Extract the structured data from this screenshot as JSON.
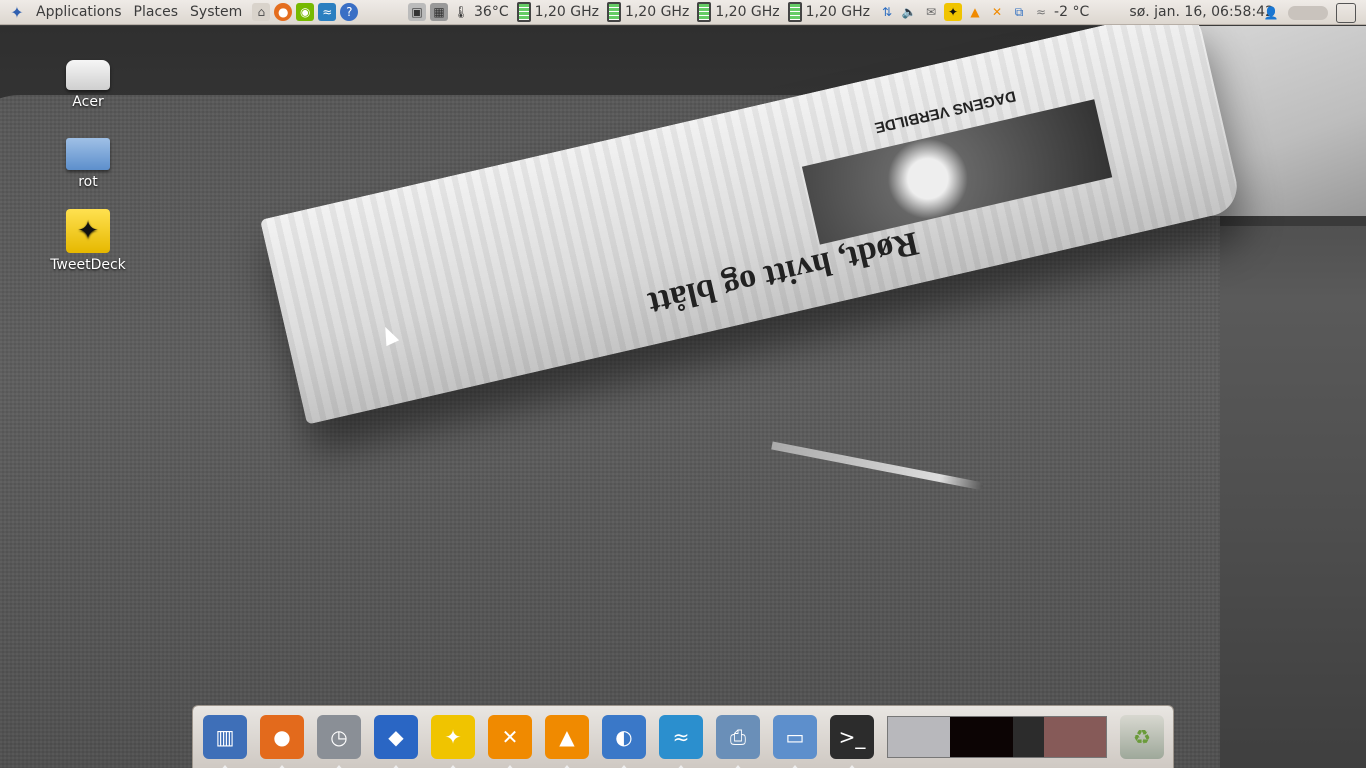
{
  "top_panel": {
    "menus": [
      "Applications",
      "Places",
      "System"
    ],
    "temperature": "36°C",
    "cpu_freqs": [
      "1,20 GHz",
      "1,20 GHz",
      "1,20 GHz",
      "1,20 GHz"
    ],
    "weather": "-2 °C",
    "clock": "sø. jan. 16, 06:58:42",
    "icons": [
      "distributor-logo-icon",
      "home-folder-icon",
      "firefox-icon",
      "nvidia-icon",
      "system-monitor-icon",
      "help-icon"
    ]
  },
  "desktop_icons": [
    {
      "label": "Acer",
      "icon": "drive-icon"
    },
    {
      "label": "rot",
      "icon": "folder-icon"
    },
    {
      "label": "TweetDeck",
      "icon": "tweetdeck-icon"
    }
  ],
  "wallpaper": {
    "headline": "Rødt, hvitt og blått",
    "band": "DAGENS VERBILDE"
  },
  "dock": {
    "items": [
      {
        "name": "file-manager",
        "glyph": "▥",
        "color": "#3e6fb8"
      },
      {
        "name": "firefox",
        "glyph": "●",
        "color": "#e36a1c"
      },
      {
        "name": "mail-clock",
        "glyph": "◷",
        "color": "#8a8f96"
      },
      {
        "name": "drop",
        "glyph": "◆",
        "color": "#2a66c4"
      },
      {
        "name": "tweetdeck",
        "glyph": "✦",
        "color": "#f0c400"
      },
      {
        "name": "xchat",
        "glyph": "✕",
        "color": "#f08a00"
      },
      {
        "name": "vlc",
        "glyph": "▲",
        "color": "#f08a00"
      },
      {
        "name": "evolution",
        "glyph": "◐",
        "color": "#3a78c8"
      },
      {
        "name": "system-monitor",
        "glyph": "≈",
        "color": "#2b8fce"
      },
      {
        "name": "printer",
        "glyph": "⎙",
        "color": "#6a8fb8"
      },
      {
        "name": "folder",
        "glyph": "▭",
        "color": "#5d8fcc"
      },
      {
        "name": "terminal",
        "glyph": ">_",
        "color": "#2c2c2c"
      }
    ],
    "swatch_colors": [
      "#b8b8bc",
      "#0c0404",
      "#2c2c2c",
      "#865a58"
    ]
  }
}
